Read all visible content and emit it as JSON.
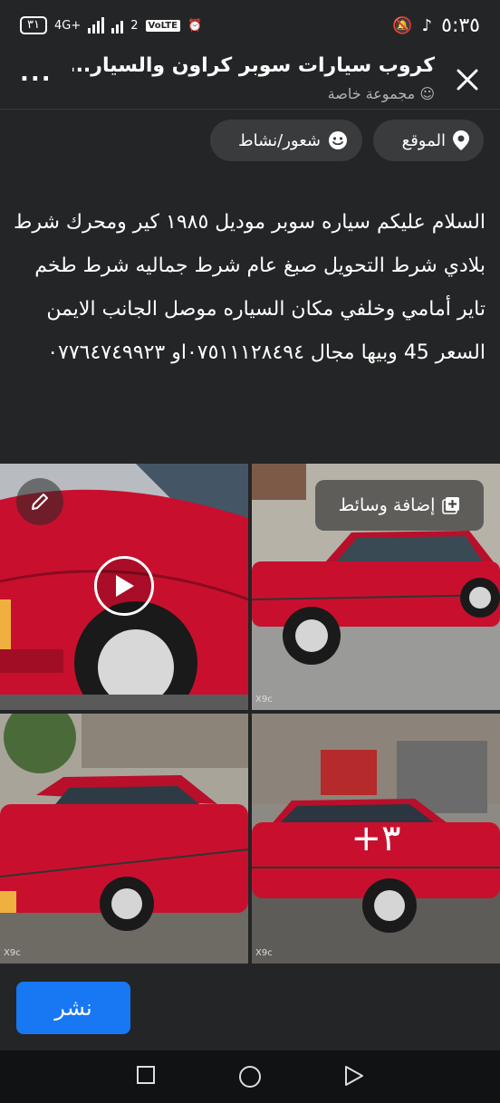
{
  "status_bar": {
    "time": "٥:٣٥",
    "battery": "٣١",
    "network": "4G+",
    "sim2": "2",
    "volte": "VoLTE"
  },
  "header": {
    "title": "كروب سيارات سوبر كراون والسيار...",
    "subtitle": "مجموعة خاصة",
    "more": "..."
  },
  "chips": {
    "location": "الموقع",
    "feeling": "شعور/نشاط"
  },
  "post": {
    "text": "السلام عليكم سياره سوبر موديل ١٩٨٥ كير ومحرك شرط بلادي شرط التحويل صبغ عام شرط جماليه شرط طخم تاير أمامي وخلفي مكان السياره موصل الجانب الايمن السعر 45 وبيها مجال ٠٧٥١١١٢٨٤٩٤او ٠٧٧٦٤٧٤٩٩٢٣"
  },
  "media": {
    "add_media_label": "إضافة وسائط",
    "more_count": "+٣",
    "watermark": "X9c"
  },
  "actions": {
    "post_button": "نشر"
  },
  "colors": {
    "background": "#242526",
    "accent": "#1877f2",
    "car": "#c8102e"
  }
}
